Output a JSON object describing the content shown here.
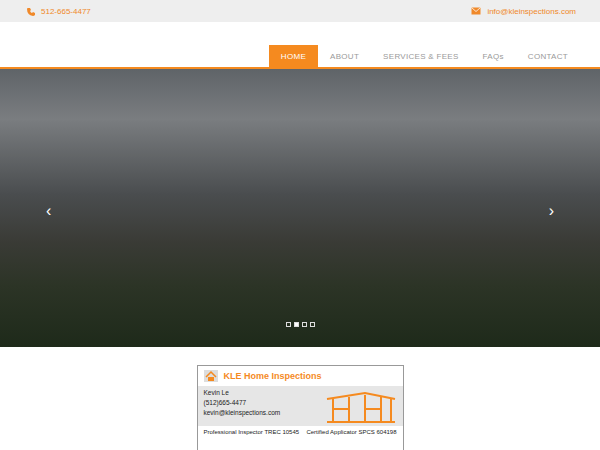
{
  "topbar": {
    "phone": "512-665-4477",
    "email": "info@kleinspections.com"
  },
  "nav": [
    {
      "label": "HOME",
      "selected": true
    },
    {
      "label": "ABOUT",
      "selected": false
    },
    {
      "label": "SERVICES & FEES",
      "selected": false
    },
    {
      "label": "FAQs",
      "selected": false
    },
    {
      "label": "CONTACT",
      "selected": false
    }
  ],
  "carousel": {
    "prev": "‹",
    "next": "›",
    "slides": [
      {
        "selected": false
      },
      {
        "selected": true
      },
      {
        "selected": false
      },
      {
        "selected": false
      }
    ]
  },
  "card": {
    "title": "KLE Home Inspections",
    "name": "Kevin Le",
    "phone": "(512)665-4477",
    "email": "kevin@kleinspections.com",
    "license": "Professional Inspector TREC 10545",
    "certification": "Certified Applicator SPCS 604198"
  }
}
